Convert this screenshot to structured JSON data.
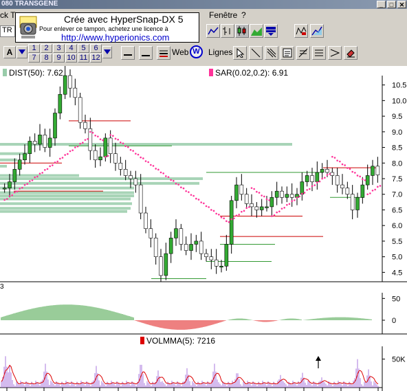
{
  "window": {
    "title": "080 TRANSGENE",
    "buttons": [
      "_",
      "□",
      "✕"
    ]
  },
  "menu": {
    "items": [
      {
        "label": "ck T",
        "name": "menu-item-partial"
      },
      {
        "label": "Fenêtre",
        "name": "menu-item-fenetre"
      },
      {
        "label": "?",
        "name": "menu-item-help"
      }
    ]
  },
  "stamp": {
    "line1": "Crée avec HyperSnap-DX 5",
    "line2": "Pour enlever ce tampon, achetez une licence à",
    "line3": "http://www.hyperionics.com"
  },
  "toolbar1": {
    "left_combo": "TR",
    "icons": [
      "line-chart-icon",
      "ohlc-chart-icon",
      "candle-chart-icon",
      "mountain-chart-icon",
      "dropdown-arrow-icon",
      "annotate-icon",
      "trend-icon"
    ]
  },
  "toolbar2": {
    "font_button": "A",
    "number_buttons_row1": [
      "1",
      "2",
      "3",
      "4",
      "5",
      "6"
    ],
    "number_buttons_row2": [
      "7",
      "8",
      "9",
      "10",
      "11",
      "12"
    ],
    "web_label": "Web",
    "web_icon_letter": "W",
    "lines_label": "Lignes"
  },
  "indicators": {
    "dist_label": "DIST(50):",
    "dist_value": "7.62",
    "dist_color": "#99ccaa",
    "sar_label": "SAR(0.02,0.2):",
    "sar_value": "6.91",
    "sar_color": "#ff3399",
    "volmma_label": "VOLMMA(5):",
    "volmma_value": "7216",
    "volmma_color": "#dd0000",
    "side_marker": "3"
  },
  "colors": {
    "candle_up": "#33aa33",
    "sar_dots": "#ff3399",
    "osc_positive": "#339933",
    "osc_negative": "#dd0000",
    "volume": "#aa77dd",
    "volume_ma": "#dd0000",
    "support_line": "#339933",
    "resistance_line": "#cc0000"
  },
  "chart_data": [
    {
      "type": "candlestick",
      "title": "",
      "y_ticks": [
        "10.5",
        "10.0",
        "9.5",
        "9.0",
        "8.5",
        "8.0",
        "7.5",
        "7.0",
        "6.5",
        "6.0",
        "5.5",
        "5.0",
        "4.5"
      ],
      "ylim": [
        4.2,
        10.8
      ],
      "grid": false,
      "close_series": [
        7.2,
        7.4,
        7.8,
        8.1,
        8.3,
        8.7,
        8.6,
        8.9,
        8.5,
        8.8,
        9.6,
        10.2,
        10.8,
        10.4,
        10.1,
        9.3,
        9.1,
        8.4,
        8.1,
        8.2,
        8.8,
        8.3,
        8.0,
        7.8,
        7.6,
        7.5,
        7.3,
        6.4,
        5.9,
        5.6,
        5.0,
        4.4,
        5.1,
        5.6,
        5.9,
        5.4,
        5.2,
        5.4,
        5.5,
        5.1,
        5.0,
        4.9,
        4.7,
        4.7,
        5.4,
        6.8,
        7.3,
        7.0,
        6.7,
        6.6,
        6.5,
        6.6,
        6.6,
        6.9,
        7.1,
        6.9,
        7.0,
        6.9,
        7.0,
        7.4,
        7.6,
        7.4,
        7.7,
        7.8,
        7.7,
        7.6,
        7.3,
        7.2,
        7.0,
        6.5,
        6.9,
        7.3,
        7.6,
        7.9,
        7.62
      ]
    },
    {
      "type": "area",
      "y_ticks": [
        "50",
        "0"
      ],
      "ylim": [
        -40,
        60
      ]
    },
    {
      "type": "bar",
      "series_name": "VOLMMA(5)",
      "y_ticks": [
        "50K"
      ],
      "last_value": 7216
    }
  ]
}
